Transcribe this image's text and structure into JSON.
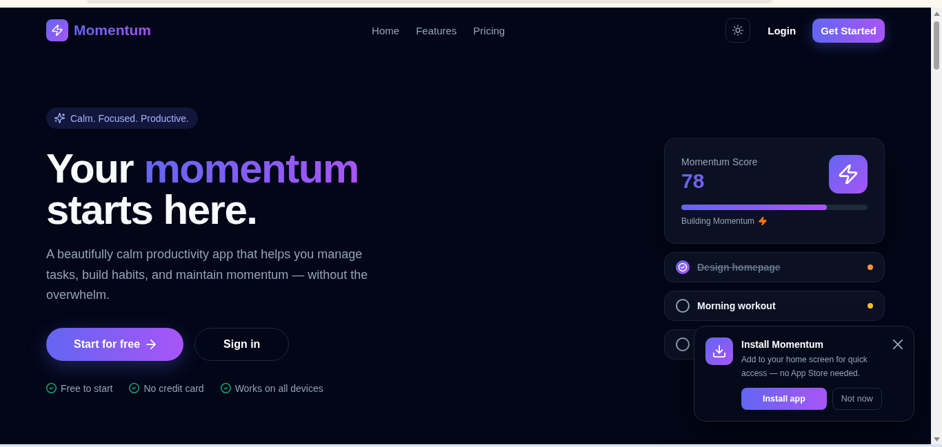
{
  "nav": {
    "brand": "Momentum",
    "links": [
      {
        "label": "Home"
      },
      {
        "label": "Features"
      },
      {
        "label": "Pricing"
      }
    ],
    "login": "Login",
    "cta": "Get Started"
  },
  "hero": {
    "badge": "Calm. Focused. Productive.",
    "title_start": "Your",
    "title_accent": "momentum",
    "title_end": "starts here.",
    "description": "A beautifully calm productivity app that helps you manage tasks, build habits, and maintain momentum — without the overwhelm.",
    "primary_button": "Start for free",
    "secondary_button": "Sign in",
    "perks": [
      "Free to start",
      "No credit card",
      "Works on all devices"
    ]
  },
  "score": {
    "label": "Momentum Score",
    "value": "78",
    "level": 0.78,
    "status": "Building Momentum"
  },
  "tasks": [
    {
      "title": "Design homepage",
      "done": true,
      "color": "#fb923c"
    },
    {
      "title": "Morning workout",
      "done": false,
      "color": "#fbbf24"
    },
    {
      "done": false
    }
  ],
  "install_prompt": {
    "title": "Install Momentum",
    "description": "Add to your home screen for quick access — no App Store needed.",
    "primary_button": "Install app",
    "secondary_button": "Not now"
  }
}
